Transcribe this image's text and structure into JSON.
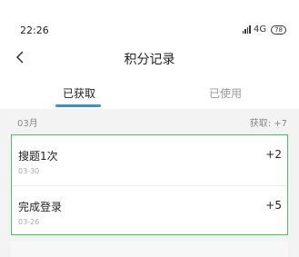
{
  "status_bar": {
    "time": "22:26",
    "network": "4G",
    "battery": "78"
  },
  "nav": {
    "title": "积分记录",
    "back_icon": "chevron-left-icon"
  },
  "tabs": [
    {
      "label": "已获取",
      "active": true
    },
    {
      "label": "已使用",
      "active": false
    }
  ],
  "accent_color": "#3b8fd8",
  "highlight_color": "#4cc35a",
  "month_group": {
    "month": "03月",
    "summary": "获取: +7"
  },
  "records": [
    {
      "name": "搜题1次",
      "date": "03-30",
      "points": "+2"
    },
    {
      "name": "完成登录",
      "date": "03-26",
      "points": "+5"
    }
  ]
}
